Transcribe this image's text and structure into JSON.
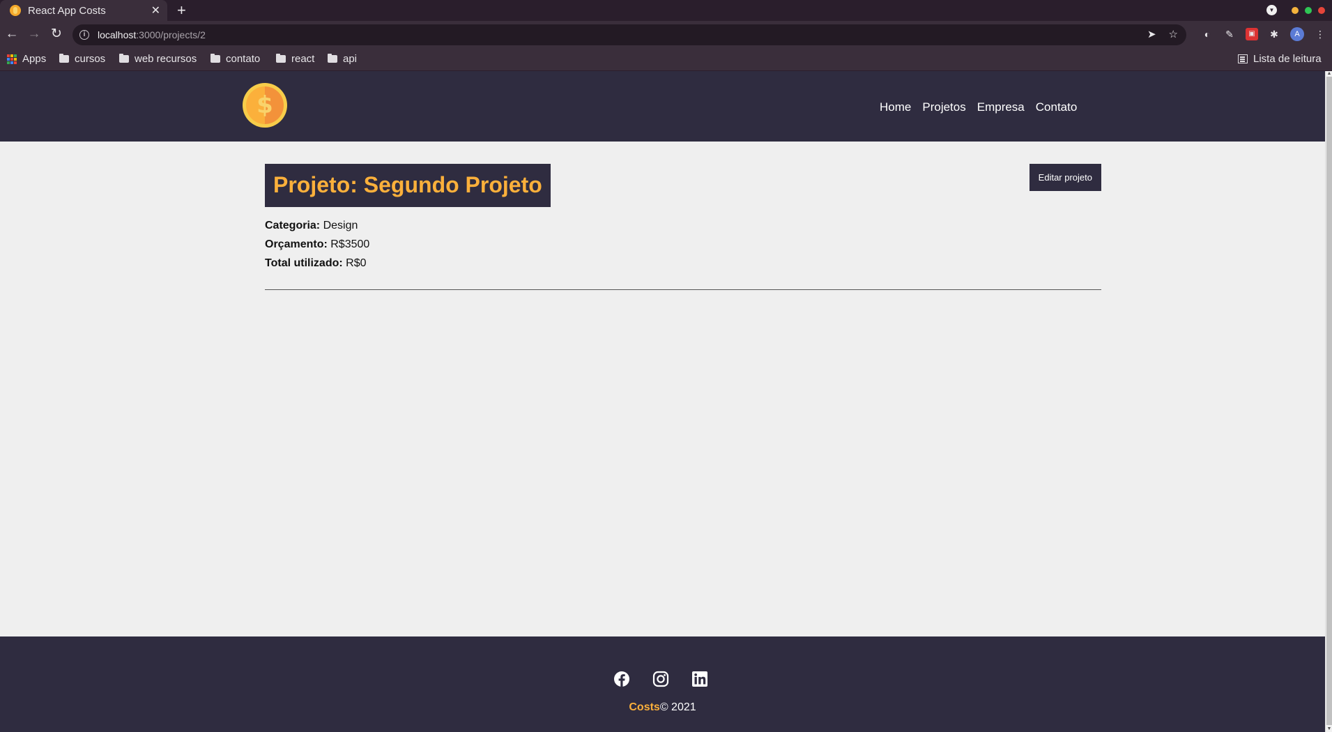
{
  "browser": {
    "tab_title": "React App Costs",
    "tab_close": "✕",
    "new_tab": "+",
    "url_host": "localhost",
    "url_rest": ":3000/projects/2",
    "bookmarks": [
      {
        "label": "Apps",
        "icon": "apps-icon"
      },
      {
        "label": "cursos",
        "icon": "folder-icon"
      },
      {
        "label": "web recursos",
        "icon": "folder-icon"
      },
      {
        "label": "contato",
        "icon": "folder-icon"
      },
      {
        "label": "react",
        "icon": "folder-icon"
      },
      {
        "label": "api",
        "icon": "folder-icon"
      }
    ],
    "reading_list": "Lista de leitura",
    "profile_initial": "A",
    "window_dots": [
      "#f4b33d",
      "#2fc655",
      "#e6453a"
    ]
  },
  "nav": {
    "links": [
      "Home",
      "Projetos",
      "Empresa",
      "Contato"
    ]
  },
  "project": {
    "title": "Projeto: Segundo Projeto",
    "edit_label": "Editar projeto",
    "category_label": "Categoria:",
    "category_value": "Design",
    "budget_label": "Orçamento:",
    "budget_value": "R$3500",
    "used_label": "Total utilizado:",
    "used_value": "R$0"
  },
  "footer": {
    "brand": "Costs",
    "copyright": "© 2021",
    "socials": [
      "facebook-icon",
      "instagram-icon",
      "linkedin-icon"
    ]
  },
  "colors": {
    "primary": "#2f2c40",
    "accent": "#fbb03b",
    "background": "#efefef"
  }
}
